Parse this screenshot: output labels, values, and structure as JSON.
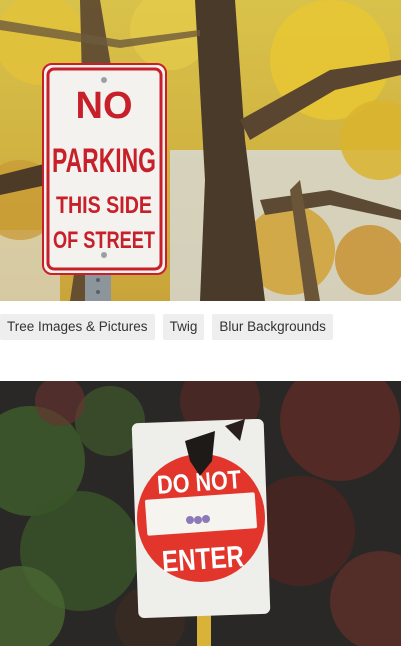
{
  "photos": [
    {
      "sign_text": [
        "NO",
        "PARKING",
        "THIS SIDE",
        "OF STREET"
      ],
      "icon": "no-parking-sign-photo"
    },
    {
      "sign_text": [
        "DO NOT",
        "ENTER"
      ],
      "icon": "do-not-enter-sign-photo"
    }
  ],
  "tags": [
    {
      "label": "Tree Images & Pictures"
    },
    {
      "label": "Twig"
    },
    {
      "label": "Blur Backgrounds"
    }
  ],
  "colors": {
    "tag_bg": "#eeeeee",
    "tag_text": "#333333",
    "sign_red": "#c8202a",
    "enter_red": "#e2362c"
  }
}
